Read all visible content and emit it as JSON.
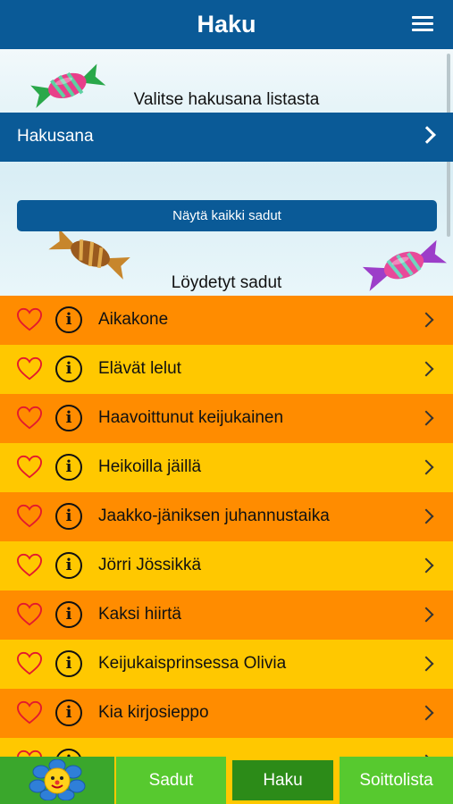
{
  "header": {
    "title": "Haku",
    "menu_icon": "hamburger-menu-icon"
  },
  "search": {
    "prompt": "Valitse hakusana listasta",
    "field_label": "Hakusana",
    "show_all_label": "Näytä kaikki sadut",
    "results_title": "Löydetyt sadut"
  },
  "results": [
    {
      "name": "Aikakone"
    },
    {
      "name": "Elävät lelut"
    },
    {
      "name": "Haavoittunut keijukainen"
    },
    {
      "name": "Heikoilla jäillä"
    },
    {
      "name": "Jaakko-jäniksen juhannustaika"
    },
    {
      "name": "Jörri Jössikkä"
    },
    {
      "name": "Kaksi hiirtä"
    },
    {
      "name": "Keijukaisprinsessa Olivia"
    },
    {
      "name": "Kia kirjosieppo"
    },
    {
      "name": ""
    }
  ],
  "tabs": {
    "tab1": "Sadut",
    "tab2": "Haku",
    "tab3": "Soittolista",
    "active": "Haku"
  },
  "colors": {
    "primary_blue": "#0a5a97",
    "row_orange": "#ff8c00",
    "row_yellow": "#ffc800",
    "tab_green": "#57c92f",
    "tab_active_green": "#2c8b18"
  }
}
